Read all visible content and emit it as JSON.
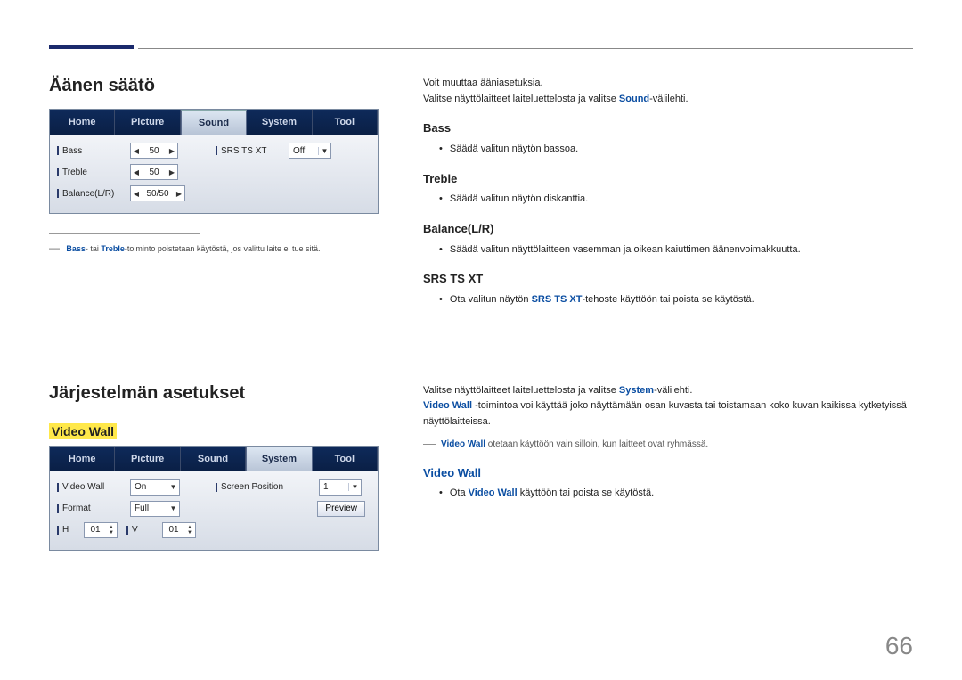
{
  "page_number": "66",
  "sound": {
    "heading": "Äänen säätö",
    "tabs": [
      "Home",
      "Picture",
      "Sound",
      "System",
      "Tool"
    ],
    "active_tab": "Sound",
    "fields": {
      "bass_label": "Bass",
      "bass_value": "50",
      "treble_label": "Treble",
      "treble_value": "50",
      "balance_label": "Balance(L/R)",
      "balance_value": "50/50",
      "srs_label": "SRS TS XT",
      "srs_value": "Off"
    },
    "footnote_pre": "― ",
    "footnote_b1": "Bass",
    "footnote_mid": "- tai ",
    "footnote_b2": "Treble",
    "footnote_rest": "-toiminto poistetaan käytöstä, jos valittu laite ei tue sitä.",
    "right": {
      "intro1": "Voit muuttaa ääniasetuksia.",
      "intro2a": "Valitse näyttölaitteet laiteluettelosta ja valitse ",
      "intro2b": "Sound",
      "intro2c": "-välilehti.",
      "bass_h": "Bass",
      "bass_t": "Säädä valitun näytön bassoa.",
      "treble_h": "Treble",
      "treble_t": "Säädä valitun näytön diskanttia.",
      "bal_h": "Balance(L/R)",
      "bal_t": "Säädä valitun näyttölaitteen vasemman ja oikean kaiuttimen äänenvoimakkuutta.",
      "srs_h": "SRS TS XT",
      "srs_t1": "Ota valitun näytön ",
      "srs_t2": "SRS TS XT",
      "srs_t3": "-tehoste käyttöön tai poista se käytöstä."
    }
  },
  "system": {
    "heading": "Järjestelmän asetukset",
    "videowall_label": "Video Wall",
    "tabs": [
      "Home",
      "Picture",
      "Sound",
      "System",
      "Tool"
    ],
    "active_tab": "System",
    "fields": {
      "vw_label": "Video Wall",
      "vw_value": "On",
      "sp_label": "Screen Position",
      "sp_value": "1",
      "fmt_label": "Format",
      "fmt_value": "Full",
      "preview_label": "Preview",
      "h_label": "H",
      "h_value": "01",
      "v_label": "V",
      "v_value": "01"
    },
    "right": {
      "intro1a": "Valitse näyttölaitteet laiteluettelosta ja valitse ",
      "intro1b": "System",
      "intro1c": "-välilehti.",
      "intro2a": "Video Wall",
      "intro2b": " -toimintoa voi käyttää joko näyttämään osan kuvasta tai toistamaan koko kuvan kaikissa kytketyissä näyttölaitteissa.",
      "note_a": "Video Wall",
      "note_b": " otetaan käyttöön vain silloin, kun laitteet ovat ryhmässä.",
      "vw_h": "Video Wall",
      "vw_t1": "Ota ",
      "vw_t2": "Video Wall",
      "vw_t3": " käyttöön tai poista se käytöstä."
    }
  }
}
